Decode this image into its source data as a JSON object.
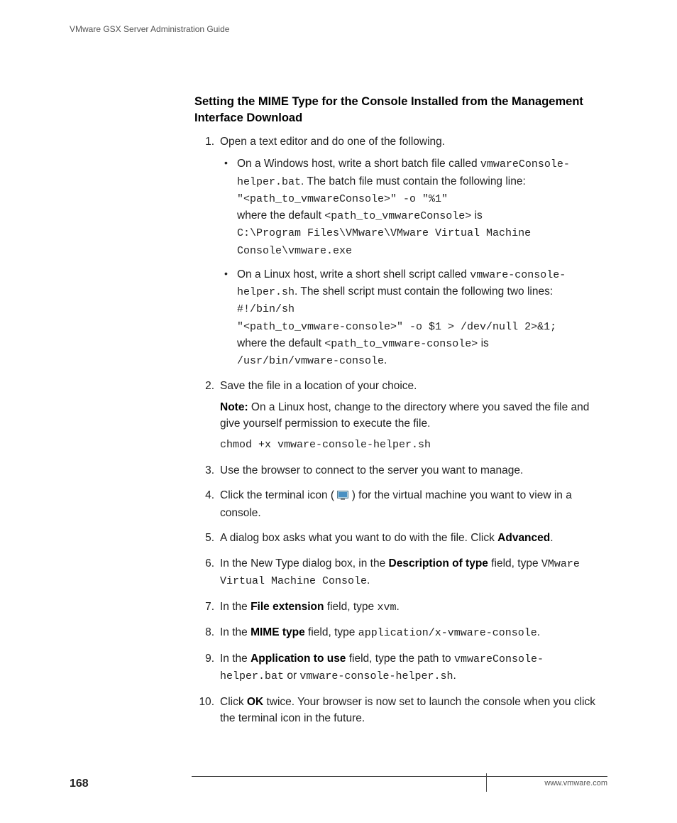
{
  "header": "VMware GSX Server Administration Guide",
  "heading": "Setting the MIME Type for the Console Installed from the Management Interface Download",
  "step1_intro": "Open a text editor and do one of the following.",
  "win_a": "On a Windows host, write a short batch file called ",
  "win_file": "vmwareConsole-helper.bat",
  "win_b": ". The batch file must contain the following line:",
  "win_code1": "\"<path_to_vmwareConsole>\" -o \"%1\"",
  "win_c": "where the default ",
  "win_path_token": "<path_to_vmwareConsole>",
  "win_d": " is",
  "win_code2": "C:\\Program Files\\VMware\\VMware Virtual Machine Console\\vmware.exe",
  "lin_a": "On a Linux host, write a short shell script called ",
  "lin_file": "vmware-console-helper.sh",
  "lin_b": ". The shell script must contain the following two lines:",
  "lin_code1": "#!/bin/sh",
  "lin_code2": "\"<path_to_vmware-console>\" -o $1 > /dev/null 2>&1;",
  "lin_c": "where the default ",
  "lin_path_token": "<path_to_vmware-console>",
  "lin_d": " is",
  "lin_code3": "/usr/bin/vmware-console",
  "period": ".",
  "step2": "Save the file in a location of your choice.",
  "note_label": "Note:",
  "note_text": "  On a Linux host, change to the directory where you saved the file and give yourself permission to execute the file.",
  "chmod": "chmod +x vmware-console-helper.sh",
  "step3": "Use the browser to connect to the server you want to manage.",
  "step4a": "Click the terminal icon ( ",
  "step4b": " ) for the virtual machine you want to view in a console.",
  "step5a": "A dialog box asks what you want to do with the file. Click ",
  "advanced": "Advanced",
  "step6a": "In the New Type dialog box, in the ",
  "desc_type": "Description of type",
  "step6b": " field, type ",
  "vm_console": "VMware Virtual Machine Console",
  "step7a": "In the ",
  "file_ext": "File extension",
  "step7b": " field, type ",
  "xvm": "xvm",
  "step8a": "In the ",
  "mime_type": "MIME type",
  "step8b": " field, type ",
  "mime_val": "application/x-vmware-console",
  "step9a": "In the ",
  "app_use": "Application to use",
  "step9b": " field, type the path to ",
  "or": " or ",
  "step10a": "Click ",
  "ok": "OK",
  "step10b": " twice. Your browser is now set to launch the console when you click the terminal icon in the future.",
  "page": "168",
  "url": "www.vmware.com"
}
